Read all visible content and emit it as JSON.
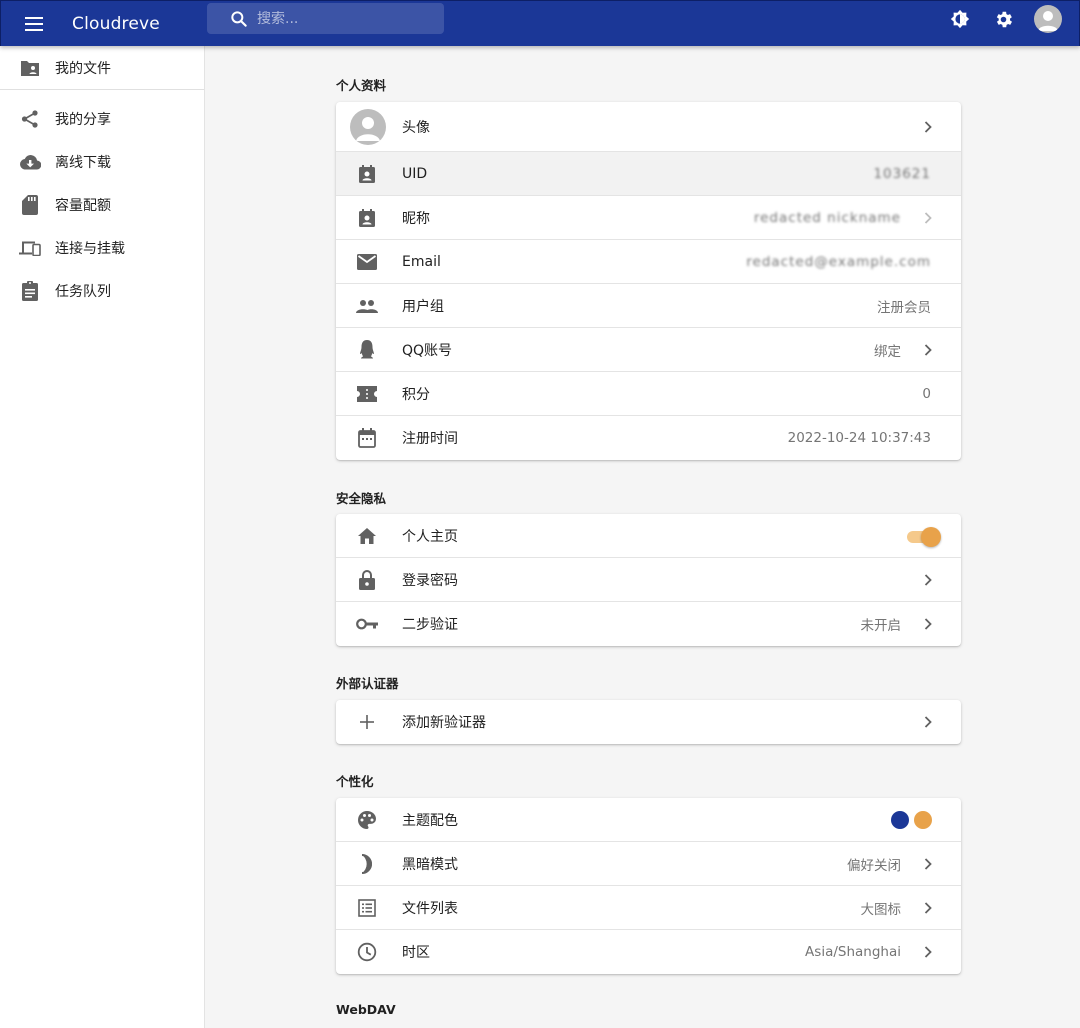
{
  "app": {
    "title": "Cloudreve",
    "search_placeholder": "搜索..."
  },
  "sidebar": {
    "items": [
      {
        "label": "我的文件",
        "icon": "folder-shared-icon"
      },
      {
        "label": "我的分享",
        "icon": "share-icon"
      },
      {
        "label": "离线下载",
        "icon": "cloud-download-icon"
      },
      {
        "label": "容量配额",
        "icon": "sd-storage-icon"
      },
      {
        "label": "连接与挂载",
        "icon": "devices-icon"
      },
      {
        "label": "任务队列",
        "icon": "assignment-icon"
      }
    ]
  },
  "profile": {
    "section_title": "个人资料",
    "avatar_label": "头像",
    "rows": [
      {
        "label": "UID",
        "value": "103621",
        "icon": "badge-icon"
      },
      {
        "label": "昵称",
        "value": "redacted nickname",
        "icon": "badge-icon"
      },
      {
        "label": "Email",
        "value": "redacted@example.com",
        "icon": "mail-icon"
      },
      {
        "label": "用户组",
        "value": "注册会员",
        "icon": "group-icon"
      },
      {
        "label": "QQ账号",
        "value": "绑定",
        "icon": "qq-icon"
      },
      {
        "label": "积分",
        "value": "0",
        "icon": "ticket-icon"
      },
      {
        "label": "注册时间",
        "value": "2022-10-24 10:37:43",
        "icon": "calendar-icon"
      }
    ]
  },
  "security": {
    "section_title": "安全隐私",
    "rows": [
      {
        "label": "个人主页",
        "value": "",
        "icon": "home-icon",
        "toggle_on": true
      },
      {
        "label": "登录密码",
        "value": "",
        "icon": "lock-icon"
      },
      {
        "label": "二步验证",
        "value": "未开启",
        "icon": "key-icon"
      }
    ]
  },
  "authenticators": {
    "section_title": "外部认证器",
    "rows": [
      {
        "label": "添加新验证器",
        "icon": "add-icon"
      }
    ]
  },
  "personalization": {
    "section_title": "个性化",
    "rows": [
      {
        "label": "主题配色",
        "icon": "palette-icon",
        "colors": [
          "#1b3797",
          "#e8a24a"
        ]
      },
      {
        "label": "黑暗模式",
        "value": "偏好关闭",
        "icon": "moon-icon"
      },
      {
        "label": "文件列表",
        "value": "大图标",
        "icon": "list-icon"
      },
      {
        "label": "时区",
        "value": "Asia/Shanghai",
        "icon": "clock-icon"
      }
    ]
  },
  "webdav": {
    "section_title": "WebDAV"
  },
  "colors": {
    "primary": "#1b3797",
    "secondary": "#e8a24a"
  }
}
